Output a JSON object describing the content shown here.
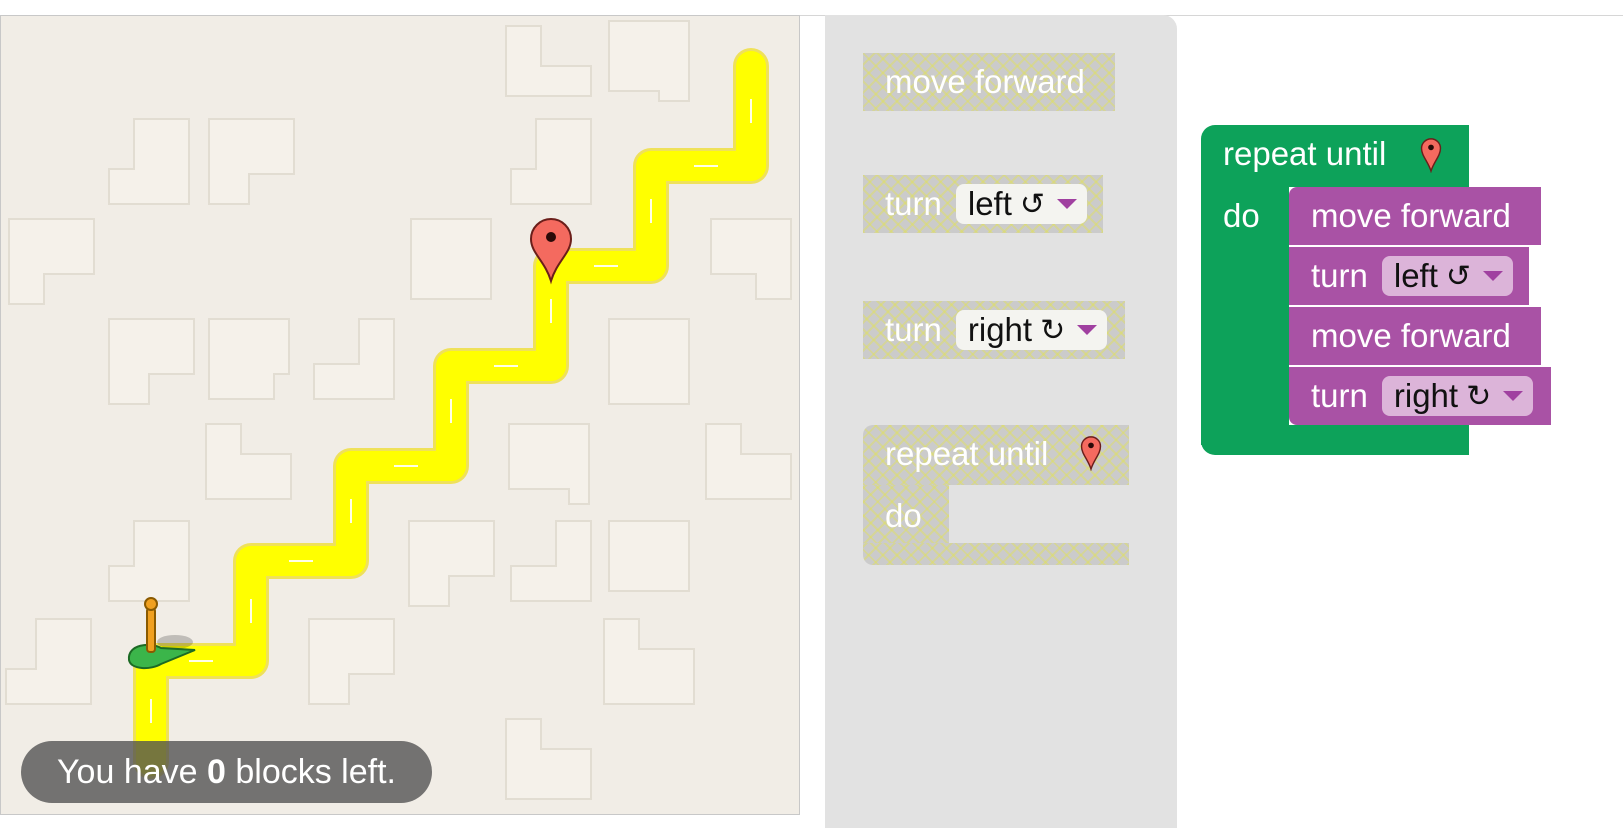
{
  "status": {
    "prefix": "You have ",
    "count": "0",
    "suffix": " blocks left."
  },
  "toolbox": {
    "move_forward": "move forward",
    "turn_left": {
      "label": "turn",
      "direction": "left",
      "rotate_symbol": "↺"
    },
    "turn_right": {
      "label": "turn",
      "direction": "right",
      "rotate_symbol": "↻"
    },
    "repeat": {
      "label": "repeat until",
      "do_label": "do",
      "icon": "map-marker-icon"
    }
  },
  "program": {
    "repeat_label": "repeat until",
    "do_label": "do",
    "icon": "map-marker-icon",
    "statements": [
      {
        "type": "move",
        "label": "move forward"
      },
      {
        "type": "turn",
        "label": "turn",
        "direction": "left",
        "rotate_symbol": "↺"
      },
      {
        "type": "move",
        "label": "move forward"
      },
      {
        "type": "turn",
        "label": "turn",
        "direction": "right",
        "rotate_symbol": "↻"
      }
    ]
  },
  "colors": {
    "path": "#ffff00",
    "loop_block": "#0da25a",
    "action_block": "#a952a5",
    "marker": "#f46a5f",
    "pegman": "#3bb54a"
  }
}
